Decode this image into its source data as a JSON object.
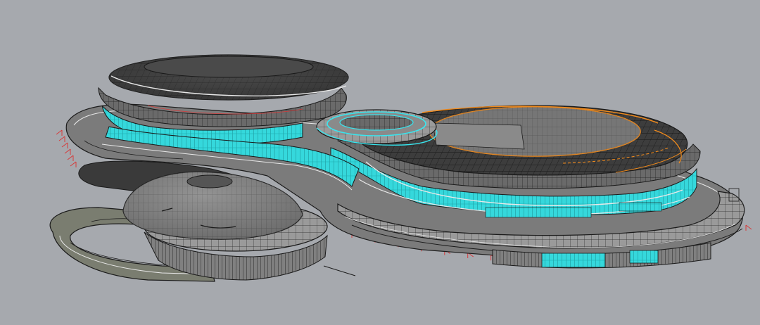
{
  "viewport": {
    "background": "#a6a9ae"
  },
  "colors": {
    "wire": "#1a1a1a",
    "roof_dark": "#3c3c3c",
    "roof_mid": "#5e5e5e",
    "glass": "#35d8dc",
    "glass_dark": "#1aa9ad",
    "edge_highlight": "#e8e8e8",
    "selection_orange": "#f08a1c",
    "selection_cyan": "#39e6ef",
    "dimension_red": "#d63a3a",
    "podium": "#6f6f6f",
    "ramp": "#7a7d70"
  },
  "model": {
    "volumes": [
      "large-dome-arena",
      "oval-stadium",
      "small-dome-hall",
      "ring-plaza",
      "curved-ramp"
    ]
  }
}
